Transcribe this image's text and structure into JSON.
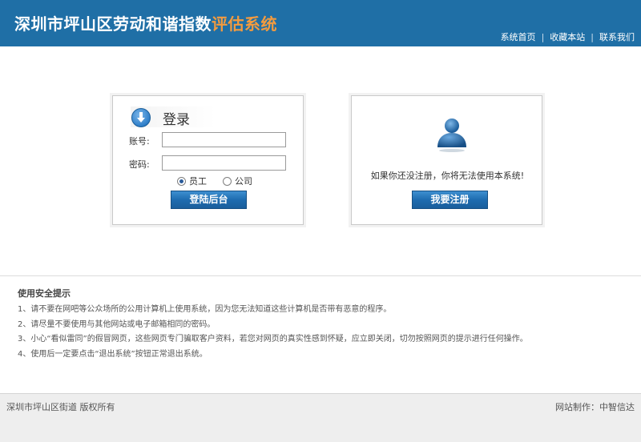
{
  "header": {
    "title_main": "深圳市坪山区劳动和谐指数",
    "title_accent": "评估系统",
    "links": [
      "系统首页",
      "收藏本站",
      "联系我们"
    ]
  },
  "login": {
    "title": "登录",
    "account_label": "账号:",
    "password_label": "密码:",
    "account_value": "",
    "password_value": "",
    "radio_employee": "员工",
    "radio_company": "公司",
    "selected_role": "员工",
    "submit_label": "登陆后台"
  },
  "register": {
    "message": "如果你还没注册，你将无法使用本系统!",
    "button_label": "我要注册"
  },
  "tips": {
    "title": "使用安全提示",
    "items": [
      "1、请不要在网吧等公众场所的公用计算机上使用系统，因为您无法知道这些计算机是否带有恶意的程序。",
      "2、请尽量不要使用与其他网站或电子邮箱相同的密码。",
      "3、小心“看似雷同”的假冒网页，这些网页专门骗取客户资料，若您对网页的真实性感到怀疑，应立即关闭，切勿按照网页的提示进行任何操作。",
      "4、使用后一定要点击“退出系统”按钮正常退出系统。"
    ]
  },
  "footer": {
    "copyright": "深圳市坪山区街道  版权所有",
    "credit": "网站制作：中智信达"
  },
  "colors": {
    "header_bg": "#1f6fa6",
    "title_accent": "#f39b3f",
    "button_bg": "#1e6cb0"
  },
  "icons": {
    "login": "download-arrow-icon",
    "register": "user-icon"
  }
}
